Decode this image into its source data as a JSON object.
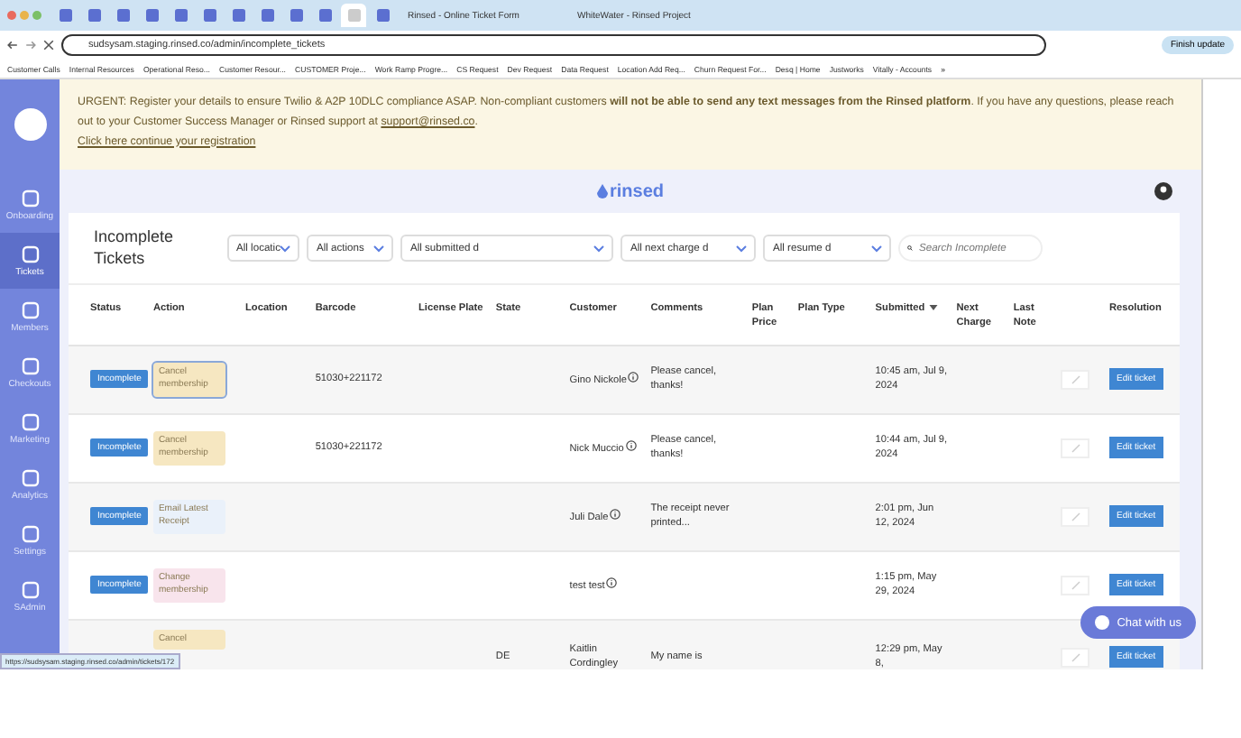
{
  "browser": {
    "tabs": [
      {
        "kind": "icon",
        "selected": false
      },
      {
        "kind": "icon",
        "selected": false
      },
      {
        "kind": "icon",
        "selected": false
      },
      {
        "kind": "icon",
        "selected": false
      },
      {
        "kind": "icon",
        "selected": false
      },
      {
        "kind": "icon",
        "selected": false
      },
      {
        "kind": "icon",
        "selected": false
      },
      {
        "kind": "icon",
        "selected": false
      },
      {
        "kind": "icon",
        "selected": false
      },
      {
        "kind": "icon",
        "selected": false
      },
      {
        "kind": "icon",
        "selected": true
      },
      {
        "kind": "icon",
        "selected": false
      },
      {
        "kind": "titled",
        "title": "Rinsed - Online Ticket Form",
        "selected": false
      },
      {
        "kind": "titled",
        "title": "WhiteWater - Rinsed Project",
        "selected": false
      }
    ],
    "url": "sudsysam.staging.rinsed.co/admin/incomplete_tickets",
    "update_button": "Finish update",
    "bookmarks": [
      "Customer Calls",
      "Internal Resources",
      "Operational Reso...",
      "Customer Resour...",
      "CUSTOMER Proje...",
      "Work Ramp Progre...",
      "CS Request",
      "Dev Request",
      "Data Request",
      "Location Add Req...",
      "Churn Request For...",
      "Desq | Home",
      "Justworks",
      "Vitally - Accounts"
    ],
    "bookmarks_more": "»"
  },
  "sidebar": {
    "items": [
      {
        "label": "Onboarding",
        "selected": false
      },
      {
        "label": "Tickets",
        "selected": true
      },
      {
        "label": "Members",
        "selected": false
      },
      {
        "label": "Checkouts",
        "selected": false
      },
      {
        "label": "Marketing",
        "selected": false
      },
      {
        "label": "Analytics",
        "selected": false
      },
      {
        "label": "Settings",
        "selected": false
      },
      {
        "label": "SAdmin",
        "selected": false
      }
    ]
  },
  "banner": {
    "text": "URGENT: Register your details to ensure Twilio & A2P 10DLC compliance ASAP. Non-compliant customers **will not be able to send any text messages from the Rinsed platform**. If you have any questions, please reach out to your Customer Success Manager or Rinsed support at",
    "email": "support@rinsed.co",
    "text_after": ".",
    "link": "Click here continue your registration"
  },
  "header": {
    "logo": "rinsed"
  },
  "page": {
    "title": "Incomplete Tickets",
    "filters": [
      {
        "kind": "select",
        "label": "All locatic"
      },
      {
        "kind": "select",
        "label": "All actions"
      },
      {
        "kind": "select",
        "label": "All submitted d"
      },
      {
        "kind": "select",
        "label": "All next charge d"
      },
      {
        "kind": "select",
        "label": "All resume d"
      },
      {
        "kind": "search",
        "placeholder": "Search Incomplete"
      }
    ]
  },
  "table": {
    "columns": [
      {
        "label": "Status",
        "sorted": false
      },
      {
        "label": "Action",
        "sorted": false
      },
      {
        "label": "Location",
        "sorted": false
      },
      {
        "label": "Barcode",
        "sorted": false
      },
      {
        "label": "License Plate",
        "sorted": false
      },
      {
        "label": "State",
        "sorted": false
      },
      {
        "label": "Customer",
        "sorted": false
      },
      {
        "label": "Comments",
        "sorted": false
      },
      {
        "label": "Plan Price",
        "sorted": false
      },
      {
        "label": "Plan Type",
        "sorted": false
      },
      {
        "label": "Submitted",
        "sorted": true
      },
      {
        "label": "Next Charge",
        "sorted": false
      },
      {
        "label": "Last Note",
        "sorted": false
      },
      {
        "label": "Resolution",
        "sorted": false
      }
    ],
    "rows": [
      {
        "status": "Incomplete",
        "action": "Cancel membership",
        "color": "#f6e7c1",
        "action_focused": true,
        "barcode": "51030+221172",
        "customer": "Gino Nickole",
        "info": true,
        "comments": "Please cancel, thanks!",
        "submitted": "10:45 am, Jul 9, 2024",
        "resolution": "Edit ticket"
      },
      {
        "status": "Incomplete",
        "action": "Cancel membership",
        "color": "#f6e7c1",
        "action_focused": false,
        "barcode": "51030+221172",
        "customer": "Nick Muccio",
        "info": true,
        "comments": "Please cancel, thanks!",
        "submitted": "10:44 am, Jul 9, 2024",
        "resolution": "Edit ticket"
      },
      {
        "status": "Incomplete",
        "action": "Email Latest Receipt",
        "color": "#eaf1fa",
        "action_focused": false,
        "customer": "Juli Dale",
        "info": true,
        "comments": "The receipt never printed...",
        "submitted": "2:01 pm, Jun 12, 2024",
        "resolution": "Edit ticket"
      },
      {
        "status": "Incomplete",
        "action": "Change membership",
        "color": "#f8e4ec",
        "action_focused": false,
        "customer": "test test",
        "info": true,
        "submitted": "1:15 pm, May 29, 2024",
        "resolution": "Edit ticket"
      },
      {
        "action": "Cancel",
        "color": "#f6e7c1",
        "action_focused": false,
        "state": "DE",
        "customer": "Kaitlin Cordingley",
        "info": false,
        "comments": "My name is",
        "submitted": "12:29 pm, May 8,",
        "resolution": "Edit ticket"
      }
    ]
  },
  "chat_button": "Chat with us",
  "status_url": "https://sudsysam.staging.rinsed.co/admin/tickets/172"
}
